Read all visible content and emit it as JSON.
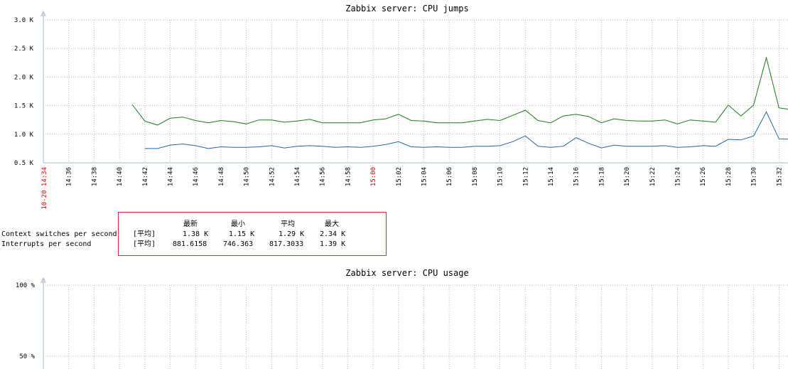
{
  "charts": [
    {
      "title": "Zabbix server: CPU jumps",
      "y_ticks": [
        "3.0 K",
        "2.5 K",
        "2.0 K",
        "1.5 K",
        "1.0 K",
        "0.5 K"
      ],
      "x_ticks": [
        {
          "label": "14:36",
          "red": false
        },
        {
          "label": "14:38",
          "red": false
        },
        {
          "label": "14:40",
          "red": false
        },
        {
          "label": "14:42",
          "red": false
        },
        {
          "label": "14:44",
          "red": false
        },
        {
          "label": "14:46",
          "red": false
        },
        {
          "label": "14:48",
          "red": false
        },
        {
          "label": "14:50",
          "red": false
        },
        {
          "label": "14:52",
          "red": false
        },
        {
          "label": "14:54",
          "red": false
        },
        {
          "label": "14:56",
          "red": false
        },
        {
          "label": "14:58",
          "red": false
        },
        {
          "label": "15:00",
          "red": true
        },
        {
          "label": "15:02",
          "red": false
        },
        {
          "label": "15:04",
          "red": false
        },
        {
          "label": "15:06",
          "red": false
        },
        {
          "label": "15:08",
          "red": false
        },
        {
          "label": "15:10",
          "red": false
        },
        {
          "label": "15:12",
          "red": false
        },
        {
          "label": "15:14",
          "red": false
        },
        {
          "label": "15:16",
          "red": false
        },
        {
          "label": "15:18",
          "red": false
        },
        {
          "label": "15:20",
          "red": false
        },
        {
          "label": "15:22",
          "red": false
        },
        {
          "label": "15:24",
          "red": false
        },
        {
          "label": "15:26",
          "red": false
        },
        {
          "label": "15:28",
          "red": false
        },
        {
          "label": "15:30",
          "red": false
        },
        {
          "label": "15:32",
          "red": false
        }
      ],
      "start_label": "10-20 14:34"
    },
    {
      "title": "Zabbix server: CPU usage",
      "y_ticks": [
        "100 %",
        "50 %"
      ]
    }
  ],
  "chart_data": [
    {
      "type": "line",
      "title": "Zabbix server: CPU jumps",
      "xlabel": "",
      "ylabel": "",
      "ylim": [
        500,
        3000
      ],
      "xlim": [
        "14:34",
        "15:33"
      ],
      "grid": true,
      "series": [
        {
          "name": "Context switches per second",
          "color": "#1a7a1a",
          "x": [
            "14:41",
            "14:42",
            "14:43",
            "14:44",
            "14:45",
            "14:46",
            "14:47",
            "14:48",
            "14:49",
            "14:50",
            "14:51",
            "14:52",
            "14:53",
            "14:54",
            "14:55",
            "14:56",
            "14:57",
            "14:58",
            "14:59",
            "15:00",
            "15:01",
            "15:02",
            "15:03",
            "15:04",
            "15:05",
            "15:06",
            "15:07",
            "15:08",
            "15:09",
            "15:10",
            "15:11",
            "15:12",
            "15:13",
            "15:14",
            "15:15",
            "15:16",
            "15:17",
            "15:18",
            "15:19",
            "15:20",
            "15:21",
            "15:22",
            "15:23",
            "15:24",
            "15:25",
            "15:26",
            "15:27",
            "15:28",
            "15:29",
            "15:30",
            "15:31",
            "15:32",
            "15:33"
          ],
          "values": [
            1520,
            1230,
            1160,
            1280,
            1300,
            1240,
            1200,
            1240,
            1220,
            1180,
            1250,
            1250,
            1210,
            1230,
            1260,
            1200,
            1200,
            1200,
            1200,
            1250,
            1270,
            1350,
            1240,
            1230,
            1200,
            1200,
            1200,
            1230,
            1260,
            1240,
            1330,
            1420,
            1240,
            1200,
            1320,
            1350,
            1310,
            1200,
            1270,
            1240,
            1230,
            1230,
            1250,
            1180,
            1250,
            1230,
            1210,
            1510,
            1320,
            1510,
            2340,
            1460,
            1430
          ]
        },
        {
          "name": "Interrupts per second",
          "color": "#1f64a8",
          "x": [
            "14:42",
            "14:43",
            "14:44",
            "14:45",
            "14:46",
            "14:47",
            "14:48",
            "14:49",
            "14:50",
            "14:51",
            "14:52",
            "14:53",
            "14:54",
            "14:55",
            "14:56",
            "14:57",
            "14:58",
            "14:59",
            "15:00",
            "15:01",
            "15:02",
            "15:03",
            "15:04",
            "15:05",
            "15:06",
            "15:07",
            "15:08",
            "15:09",
            "15:10",
            "15:11",
            "15:12",
            "15:13",
            "15:14",
            "15:15",
            "15:16",
            "15:17",
            "15:18",
            "15:19",
            "15:20",
            "15:21",
            "15:22",
            "15:23",
            "15:24",
            "15:25",
            "15:26",
            "15:27",
            "15:28",
            "15:29",
            "15:30",
            "15:31",
            "15:32",
            "15:33"
          ],
          "values": [
            750,
            750,
            810,
            830,
            800,
            750,
            780,
            770,
            770,
            780,
            800,
            760,
            790,
            800,
            790,
            770,
            780,
            770,
            790,
            820,
            870,
            780,
            770,
            780,
            770,
            770,
            790,
            790,
            800,
            870,
            970,
            790,
            770,
            790,
            940,
            840,
            760,
            810,
            790,
            790,
            790,
            800,
            770,
            780,
            800,
            790,
            910,
            900,
            970,
            1390,
            920,
            910
          ]
        }
      ]
    },
    {
      "type": "line",
      "title": "Zabbix server: CPU usage",
      "xlabel": "",
      "ylabel": "",
      "ylim": [
        0,
        100
      ],
      "grid": true,
      "series": []
    }
  ],
  "legend": {
    "headers": [
      "最新",
      "最小",
      "平均",
      "最大"
    ],
    "rows": [
      {
        "name": "Context switches per second",
        "func": "[平均]",
        "last": "1.38 K",
        "min": "1.15 K",
        "avg": "1.29 K",
        "max": "2.34 K"
      },
      {
        "name": "Interrupts per second",
        "func": "[平均]",
        "last": "881.6158",
        "min": "746.363",
        "avg": "817.3033",
        "max": "1.39 K"
      }
    ]
  },
  "colors": {
    "axis": "#a9b8c8",
    "grid": "#bbbbbb",
    "legend_border": "#d92a2a",
    "highlight_tick": "#dd0000"
  }
}
